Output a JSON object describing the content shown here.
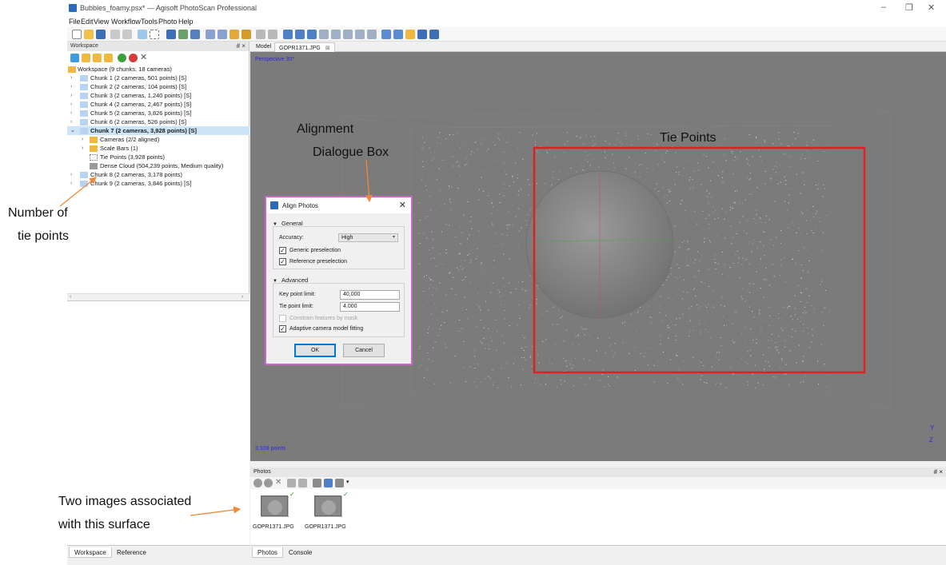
{
  "window": {
    "title": "Bubbles_foamy.psx* — Agisoft PhotoScan Professional",
    "minimize": "–",
    "restore": "❐",
    "close": "✕"
  },
  "menu": [
    "File",
    "Edit",
    "View",
    "Workflow",
    "Tools",
    "Photo",
    "Help"
  ],
  "workspace": {
    "header": "Workspace",
    "dock_icons": "# ×",
    "root": "Workspace (9 chunks, 18 cameras)",
    "chunks": [
      "Chunk 1 (2 cameras, 501 points) [S]",
      "Chunk 2 (2 cameras, 104 points) [S]",
      "Chunk 3 (2 cameras, 1,240 points) [S]",
      "Chunk 4 (2 cameras, 2,467 points) [S]",
      "Chunk 5 (2 cameras, 3,826 points) [S]",
      "Chunk 6 (2 cameras, 526 points) [S]"
    ],
    "selected_chunk": "Chunk 7 (2 cameras, 3,928 points) [S]",
    "children": [
      "Cameras (2/2 aligned)",
      "Scale Bars (1)",
      "Tie Points (3,928 points)",
      "Dense Cloud (504,239 points, Medium quality)"
    ],
    "chunks_after": [
      "Chunk 8 (2 cameras, 3,178 points)",
      "Chunk 9 (2 cameras, 3,846 points) [S]"
    ],
    "bottom_tabs": [
      "Workspace",
      "Reference"
    ]
  },
  "model_view": {
    "tabs": [
      "Model",
      "GOPR1371.JPG"
    ],
    "tab_close": "⊠",
    "perspective": "Perspective 30°",
    "point_count": "3,928 points",
    "axis_y": "Y",
    "axis_z": "Z"
  },
  "photos": {
    "header": "Photos",
    "dock_icons": "# ×",
    "items": [
      "GOPR1371.JPG",
      "GOPR1371.JPG"
    ],
    "bottom_tabs": [
      "Photos",
      "Console"
    ]
  },
  "dialog": {
    "title": "Align Photos",
    "close": "✕",
    "general_title": "General",
    "accuracy_label": "Accuracy:",
    "accuracy_value": "High",
    "generic_label": "Generic preselection",
    "reference_label": "Reference preselection",
    "advanced_title": "Advanced",
    "key_point_label": "Key point limit:",
    "key_point_value": "40,000",
    "tie_point_label": "Tie point limit:",
    "tie_point_value": "4,000",
    "constrain_label": "Constrain features by mask",
    "adaptive_label": "Adaptive camera model fitting",
    "ok": "OK",
    "cancel": "Cancel",
    "checked_mark": "✓",
    "group_marker": "▼",
    "combo_caret": "▾"
  },
  "annotations": {
    "alignment_line1": "Alignment",
    "alignment_line2": "Dialogue Box",
    "tie_points": "Tie Points",
    "number_line1": "Number of",
    "number_line2": "tie points",
    "images_line1": "Two images associated",
    "images_line2": "with this surface"
  },
  "colors": {
    "highlight_box": "#e02020",
    "annotation_arrow": "#f08a3a",
    "dialog_border": "#c966c9",
    "viewport_bg": "#7b7b7b",
    "selection": "#cce4f7"
  }
}
